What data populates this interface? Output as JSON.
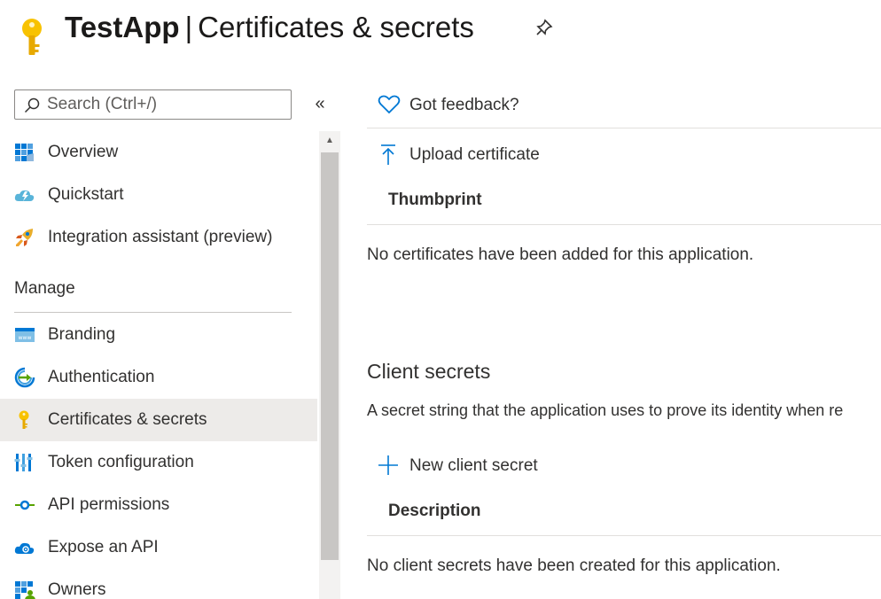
{
  "header": {
    "app_name": "TestApp",
    "separator": "|",
    "page": "Certificates & secrets"
  },
  "search": {
    "placeholder": "Search (Ctrl+/)",
    "value": ""
  },
  "collapse_glyph": "«",
  "sidebar": {
    "items_top": [
      {
        "label": "Overview",
        "icon": "overview-grid-icon"
      },
      {
        "label": "Quickstart",
        "icon": "quickstart-cloud-icon"
      },
      {
        "label": "Integration assistant (preview)",
        "icon": "rocket-icon"
      }
    ],
    "manage_header": "Manage",
    "items_manage": [
      {
        "label": "Branding",
        "icon": "branding-icon"
      },
      {
        "label": "Authentication",
        "icon": "authentication-icon"
      },
      {
        "label": "Certificates & secrets",
        "icon": "key-icon",
        "selected": true
      },
      {
        "label": "Token configuration",
        "icon": "token-bars-icon"
      },
      {
        "label": "API permissions",
        "icon": "api-permissions-icon"
      },
      {
        "label": "Expose an API",
        "icon": "expose-api-cloud-icon"
      },
      {
        "label": "Owners",
        "icon": "owners-icon"
      }
    ]
  },
  "main": {
    "feedback_label": "Got feedback?",
    "certificates": {
      "upload_label": "Upload certificate",
      "column_thumbprint": "Thumbprint",
      "empty_text": "No certificates have been added for this application."
    },
    "client_secrets": {
      "title": "Client secrets",
      "description": "A secret string that the application uses to prove its identity when re",
      "new_label": "New client secret",
      "column_description": "Description",
      "empty_text": "No client secrets have been created for this application."
    }
  },
  "colors": {
    "accent": "#0078d4",
    "selected_bg": "#edebe9",
    "key_yellow": "#f8c200"
  }
}
